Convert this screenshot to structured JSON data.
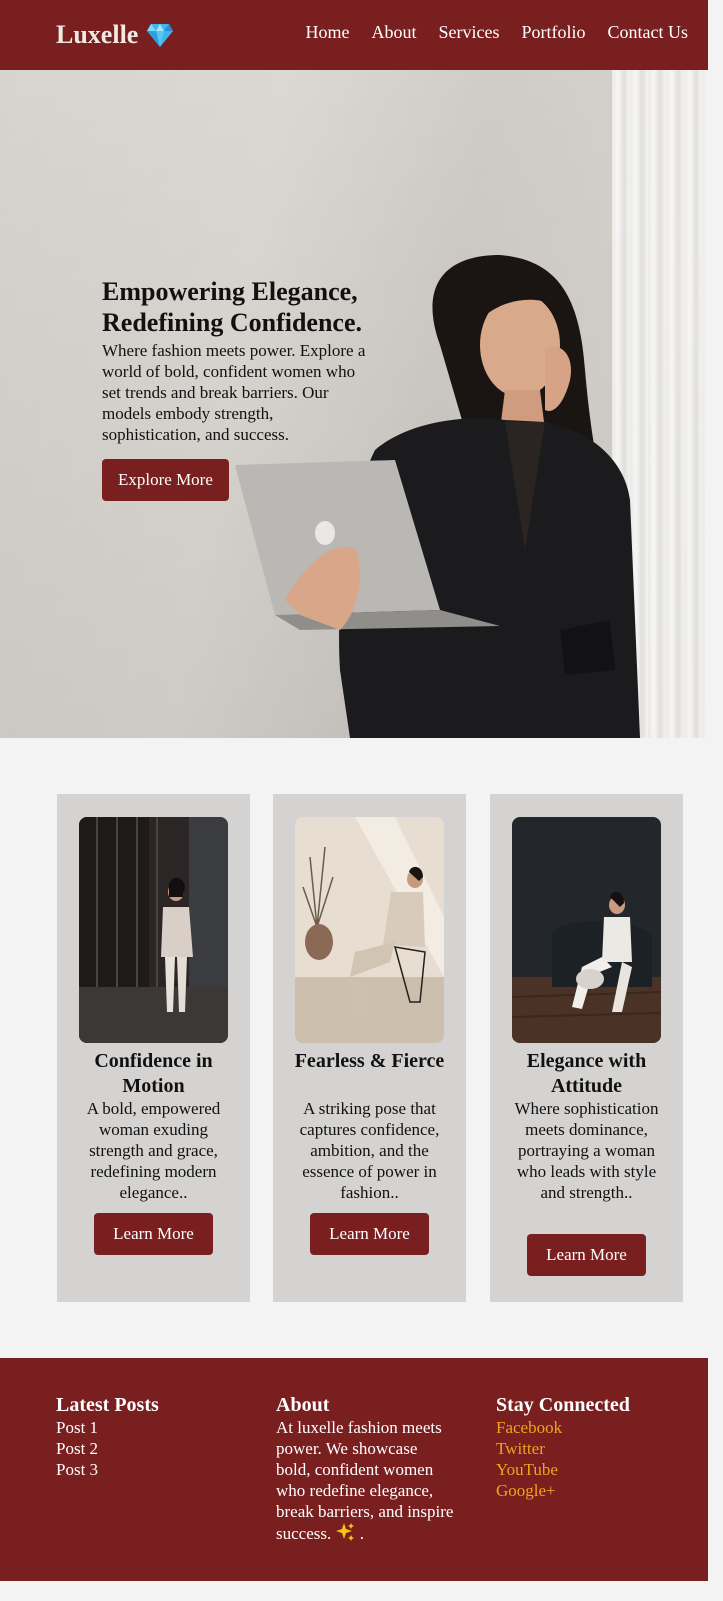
{
  "brand": {
    "name": "Luxelle"
  },
  "nav": {
    "items": [
      "Home",
      "About",
      "Services",
      "Portfolio",
      "Contact Us"
    ]
  },
  "hero": {
    "title": "Empowering Elegance, Redefining Confidence.",
    "text": "Where fashion meets power. Explore a world of bold, confident women who set trends and break barriers. Our models embody strength, sophistication, and success.",
    "button": "Explore More"
  },
  "cards": [
    {
      "title": "Confidence in Motion",
      "desc": "A bold, empowered woman exuding strength and grace, redefining modern elegance..",
      "button": "Learn More"
    },
    {
      "title": "Fearless & Fierce",
      "desc": "A striking pose that captures confidence, ambition, and the essence of power in fashion..",
      "button": "Learn More"
    },
    {
      "title": "Elegance with Attitude",
      "desc": "Where sophistication meets dominance, portraying a woman who leads with style and strength..",
      "button": "Learn More"
    }
  ],
  "footer": {
    "posts": {
      "heading": "Latest Posts",
      "items": [
        "Post 1",
        "Post 2",
        "Post 3"
      ]
    },
    "about": {
      "heading": "About",
      "text": "At luxelle fashion meets power. We showcase bold, confident women who redefine elegance, break barriers, and inspire success.",
      "suffix": "."
    },
    "social": {
      "heading": "Stay Connected",
      "items": [
        "Facebook",
        "Twitter",
        "YouTube",
        "Google+"
      ]
    }
  },
  "colors": {
    "primary": "#7a1f1f",
    "card_bg": "#d5d3d1",
    "page_bg": "#f3f3f3",
    "link": "#f2a21f"
  },
  "icons": {
    "logo": "gem-icon",
    "about": "sparkles-icon"
  }
}
